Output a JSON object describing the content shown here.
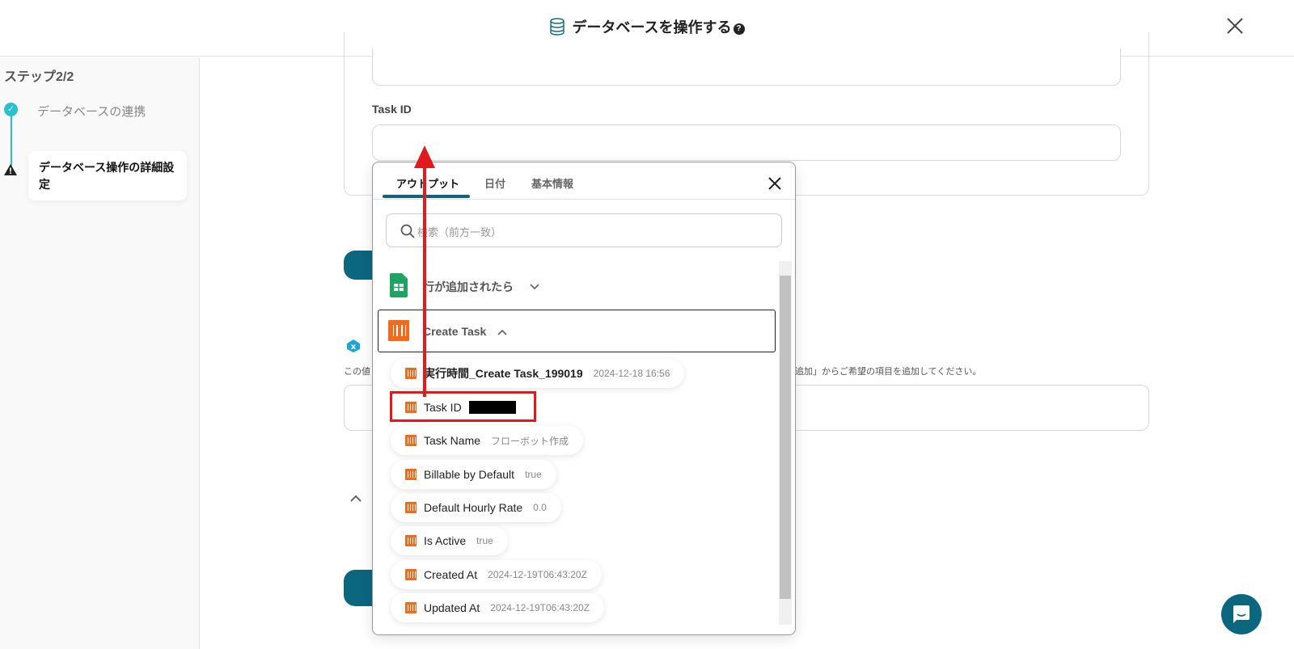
{
  "header": {
    "title": "データベースを操作する",
    "help_icon": "question-circle-icon",
    "close_icon": "close-icon"
  },
  "sidebar": {
    "step_label": "ステップ2/2",
    "steps": [
      {
        "label": "データベースの連携",
        "status": "done"
      },
      {
        "label": "データベース操作の詳細設定",
        "status": "warning"
      }
    ]
  },
  "form": {
    "task_id_label": "Task ID",
    "hint_left": "この値",
    "hint_right": "追加」からご希望の項目を追加してください。"
  },
  "popup": {
    "tabs": [
      {
        "label": "アウトプット",
        "active": true
      },
      {
        "label": "日付"
      },
      {
        "label": "基本情報"
      }
    ],
    "search_placeholder": "検索（前方一致）",
    "sections": [
      {
        "label": "行が追加されたら",
        "expanded": false
      },
      {
        "label": "Create Task",
        "expanded": true
      }
    ],
    "items": [
      {
        "key": "実行時間_Create Task_199019",
        "value": "2024-12-18 16:56"
      },
      {
        "key": "Task ID",
        "value": "",
        "redacted": true,
        "highlighted": true
      },
      {
        "key": "Task Name",
        "value": "フローボット作成"
      },
      {
        "key": "Billable by Default",
        "value": "true"
      },
      {
        "key": "Default Hourly Rate",
        "value": "0.0"
      },
      {
        "key": "Is Active",
        "value": "true"
      },
      {
        "key": "Created At",
        "value": "2024-12-19T06:43:20Z"
      },
      {
        "key": "Updated At",
        "value": "2024-12-19T06:43:20Z"
      }
    ]
  },
  "colors": {
    "accent": "#0b6680",
    "step_done": "#2bbfd0",
    "highlight": "#e01b1b",
    "yoom_orange": "#f26b1d",
    "sheets_green": "#1fa463"
  }
}
